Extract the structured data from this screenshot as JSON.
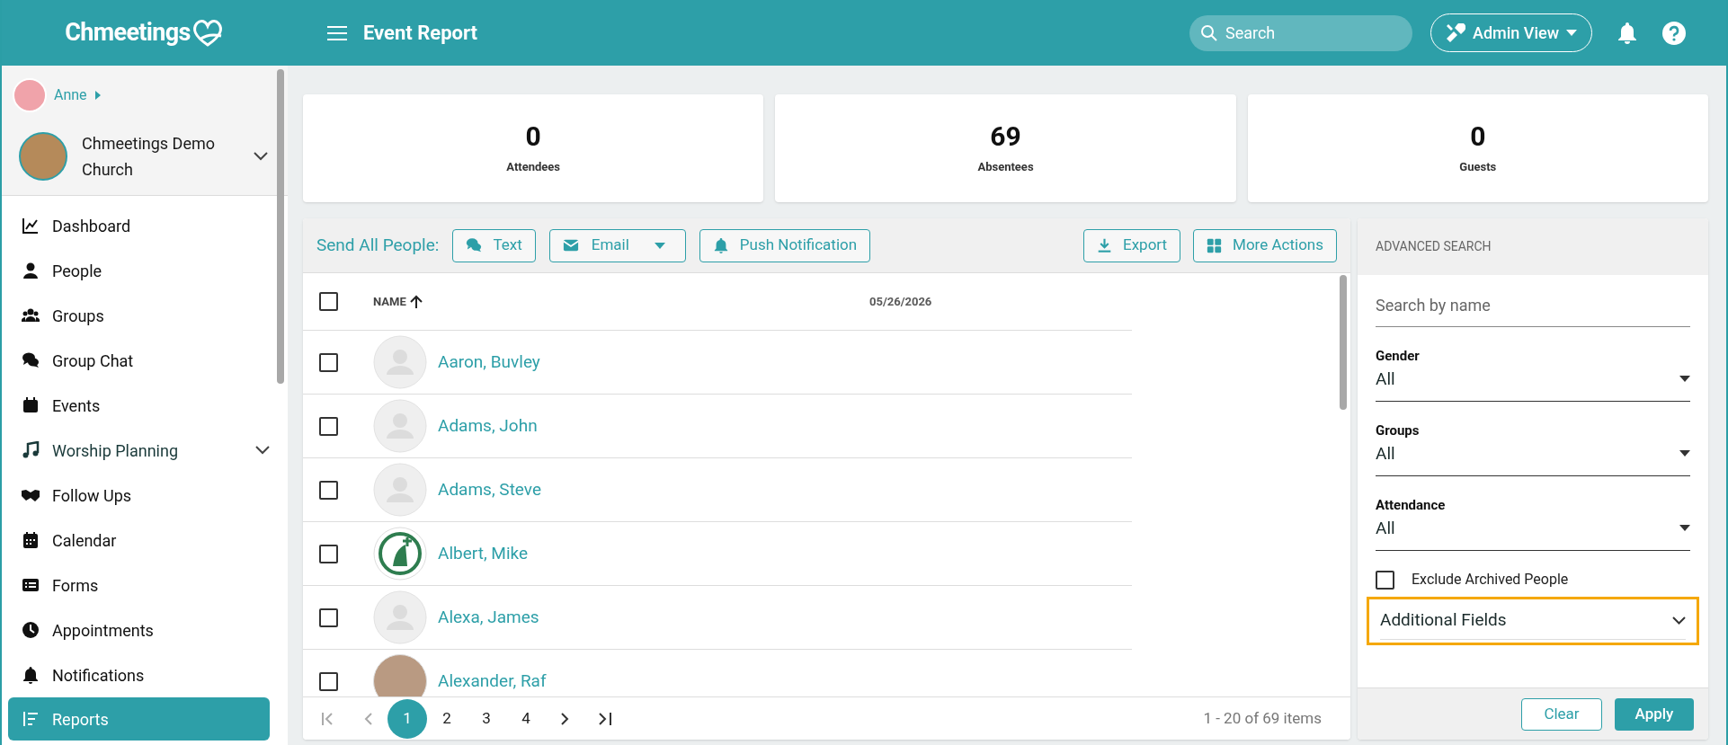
{
  "header": {
    "logo": "Chmeetings",
    "title": "Event Report",
    "search": {
      "placeholder": "Search"
    },
    "view_button": "Admin View"
  },
  "sidebar": {
    "user": "Anne",
    "church": "Chmeetings Demo Church",
    "items": [
      {
        "label": "Dashboard",
        "selected": false,
        "expandable": false
      },
      {
        "label": "People",
        "selected": false,
        "expandable": false
      },
      {
        "label": "Groups",
        "selected": false,
        "expandable": false
      },
      {
        "label": "Group Chat",
        "selected": false,
        "expandable": false
      },
      {
        "label": "Events",
        "selected": false,
        "expandable": false
      },
      {
        "label": "Worship Planning",
        "selected": false,
        "expandable": true
      },
      {
        "label": "Follow Ups",
        "selected": false,
        "expandable": false
      },
      {
        "label": "Calendar",
        "selected": false,
        "expandable": false
      },
      {
        "label": "Forms",
        "selected": false,
        "expandable": false
      },
      {
        "label": "Appointments",
        "selected": false,
        "expandable": false
      },
      {
        "label": "Notifications",
        "selected": false,
        "expandable": false
      },
      {
        "label": "Reports",
        "selected": true,
        "expandable": false
      }
    ]
  },
  "stats": [
    {
      "value": "0",
      "label": "Attendees"
    },
    {
      "value": "69",
      "label": "Absentees"
    },
    {
      "value": "0",
      "label": "Guests"
    }
  ],
  "toolbar": {
    "label": "Send All People:",
    "buttons": [
      {
        "label": "Text",
        "dropdown": false
      },
      {
        "label": "Email",
        "dropdown": true
      },
      {
        "label": "Push Notification",
        "dropdown": false
      }
    ],
    "right_buttons": [
      {
        "label": "Export"
      },
      {
        "label": "More Actions"
      }
    ]
  },
  "table": {
    "all_checked": false,
    "columns": [
      {
        "label": "NAME",
        "sorted": true
      },
      {
        "label": "05/26/2026",
        "sorted": false
      }
    ],
    "rows": [
      {
        "name": "Aaron, Buvley",
        "kind": "silhouette",
        "checked": false
      },
      {
        "name": "Adams, John",
        "kind": "silhouette",
        "checked": false
      },
      {
        "name": "Adams, Steve",
        "kind": "silhouette",
        "checked": false
      },
      {
        "name": "Albert, Mike",
        "kind": "logo",
        "checked": false
      },
      {
        "name": "Alexa, James",
        "kind": "silhouette",
        "checked": false
      },
      {
        "name": "Alexander, Raf",
        "kind": "photo",
        "checked": false
      }
    ]
  },
  "pagination": {
    "pages": [
      {
        "label": "1",
        "selected": true
      },
      {
        "label": "2",
        "selected": false
      },
      {
        "label": "3",
        "selected": false
      },
      {
        "label": "4",
        "selected": false
      }
    ],
    "summary": "1 - 20 of 69 items"
  },
  "advanced_search": {
    "title": "ADVANCED SEARCH",
    "name_field": {
      "placeholder": "Search by name"
    },
    "filters": [
      {
        "label": "Gender",
        "value": "All"
      },
      {
        "label": "Groups",
        "value": "All"
      },
      {
        "label": "Attendance",
        "value": "All"
      }
    ],
    "exclude_archived": {
      "label": "Exclude Archived People",
      "checked": false
    },
    "additional_fields": {
      "label": "Additional Fields",
      "highlighted": true
    },
    "buttons": [
      {
        "label": "Clear",
        "kind": "outline"
      },
      {
        "label": "Apply",
        "kind": "primary"
      }
    ]
  }
}
